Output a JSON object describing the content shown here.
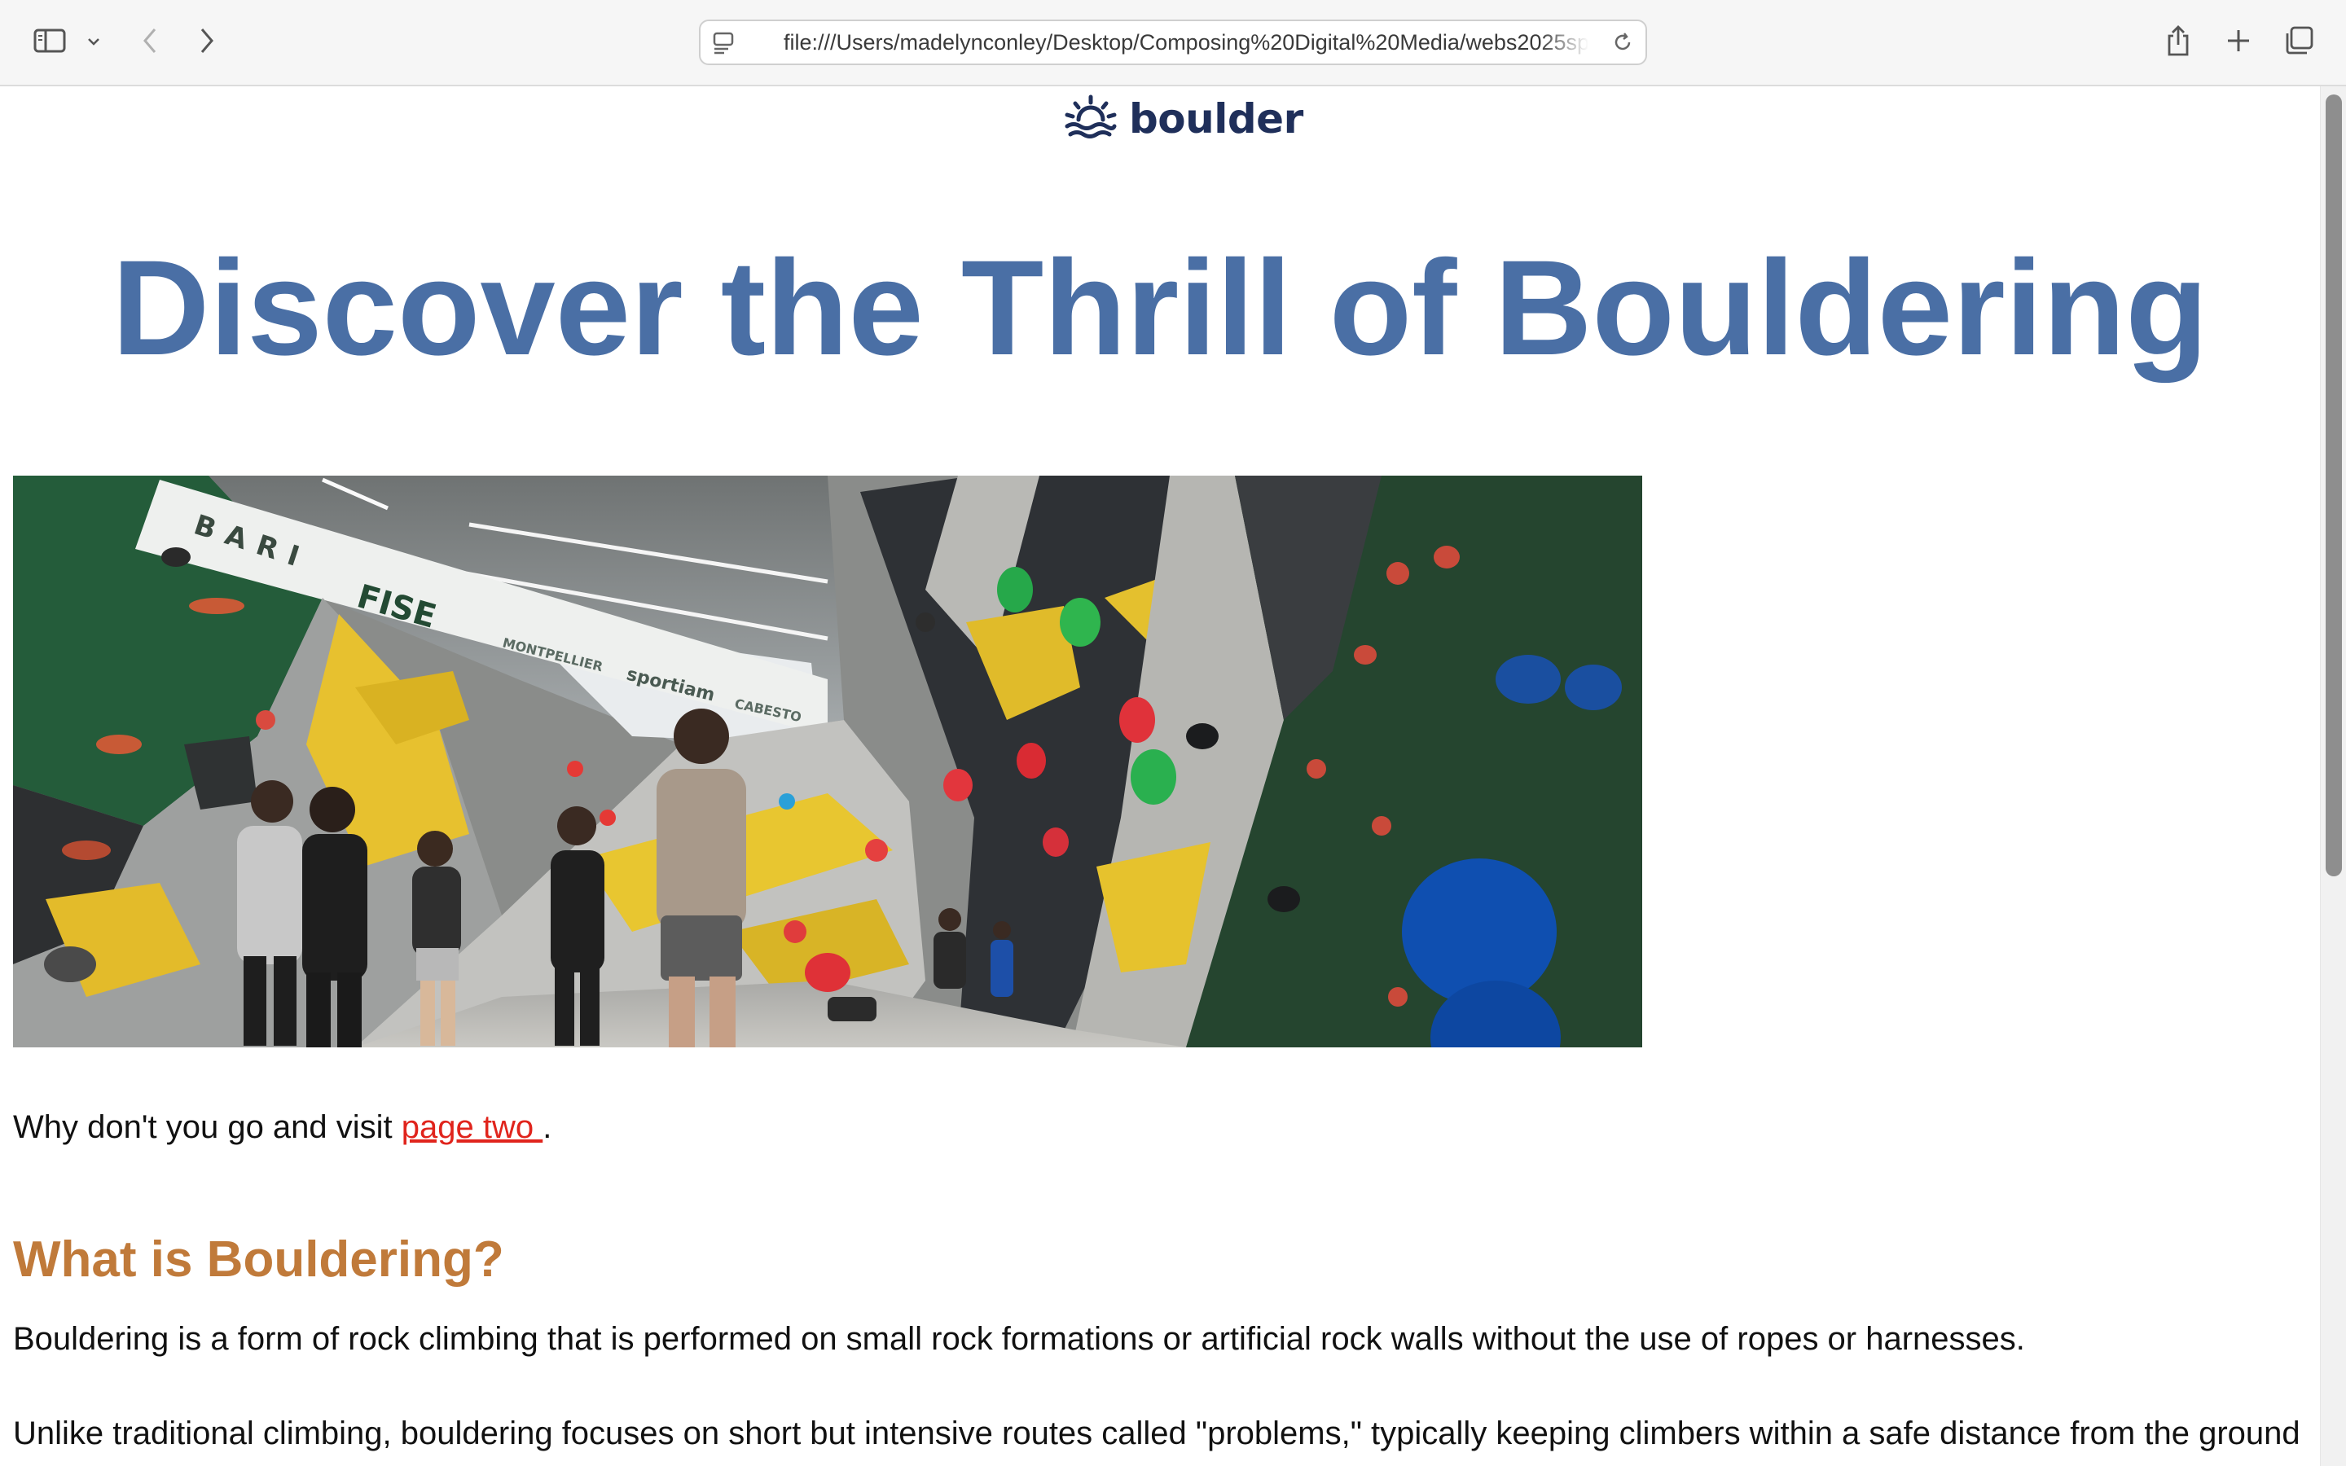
{
  "browser": {
    "url": "file:///Users/madelynconley/Desktop/Composing%20Digital%20Media/webs2025spring"
  },
  "logo": {
    "text": "boulder"
  },
  "page": {
    "title": "Discover the Thrill of Bouldering",
    "visit_prefix": "Why don't you go and visit ",
    "visit_link": "page two ",
    "visit_suffix": ".",
    "section_heading": "What is Bouldering?",
    "paragraph1": "Bouldering is a form of rock climbing that is performed on small rock formations or artificial rock walls without the use of ropes or harnesses.",
    "paragraph2": "Unlike traditional climbing, bouldering focuses on short but intensive routes called \"problems,\" typically keeping climbers within a safe distance from the ground"
  },
  "hero_image": {
    "signs": [
      "BARI",
      "FISE",
      "MONTPELLIER",
      "sportiam",
      "CABESTO"
    ]
  },
  "colors": {
    "title": "#4a6fa5",
    "heading": "#c07a3a",
    "link": "#e0241c",
    "logo": "#1f2f5a"
  }
}
